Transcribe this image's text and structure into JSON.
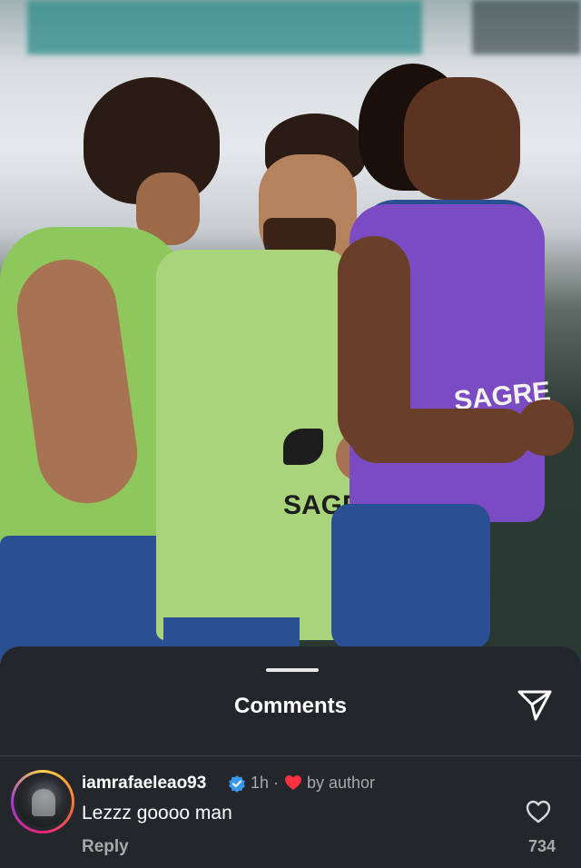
{
  "photo": {
    "bib_text_green": "SAGRE",
    "bib_text_purple": "SAGRE",
    "brand_mark": "puma-logo"
  },
  "sheet": {
    "title": "Comments",
    "send_icon": "paper-plane-icon"
  },
  "comment": {
    "username": "iamrafaeleao93",
    "verified_icon": "verified-badge-icon",
    "time": "1h",
    "separator": "·",
    "author_like_icon": "heart-icon",
    "author_like_label": "by author",
    "text": "Lezzz goooo man",
    "reply_label": "Reply",
    "like_icon": "heart-outline-icon",
    "like_count": "734"
  },
  "colors": {
    "sheet_bg": "#23262b",
    "text_primary": "#ffffff",
    "text_secondary": "#a8a8a8",
    "verified": "#3897f0",
    "author_heart": "#ff3040",
    "bib_green": "#9bd06a",
    "bib_purple": "#7b4bc4"
  }
}
